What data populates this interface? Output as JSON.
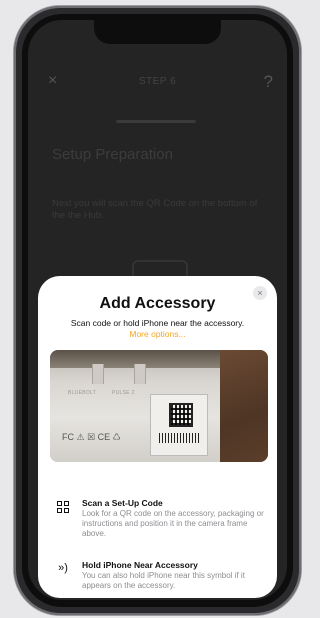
{
  "background": {
    "close_glyph": "×",
    "step_label": "STEP 6",
    "help_glyph": "?",
    "title": "Setup Preparation",
    "description": "Next you will scan the QR Code on the bottom of the the Hub."
  },
  "sheet": {
    "close_glyph": "×",
    "title": "Add Accessory",
    "subtitle": "Scan code or hold iPhone near the accessory.",
    "more_options": "More options...",
    "camera_texts": {
      "model": "PULSE 2",
      "brand": "BLUEBOLT"
    },
    "instructions": [
      {
        "icon": "qr-code-icon",
        "title": "Scan a Set-Up Code",
        "body": "Look for a QR code on the accessory, packaging or instructions and position it in the camera frame above."
      },
      {
        "icon": "nfc-icon",
        "title": "Hold iPhone Near Accessory",
        "body": "You can also hold iPhone near this symbol if it appears on the accessory."
      }
    ]
  },
  "colors": {
    "accent": "#f5a623",
    "screen_bg": "#242425",
    "sheet_bg": "#ffffff",
    "secondary_text": "#8e8e93"
  }
}
